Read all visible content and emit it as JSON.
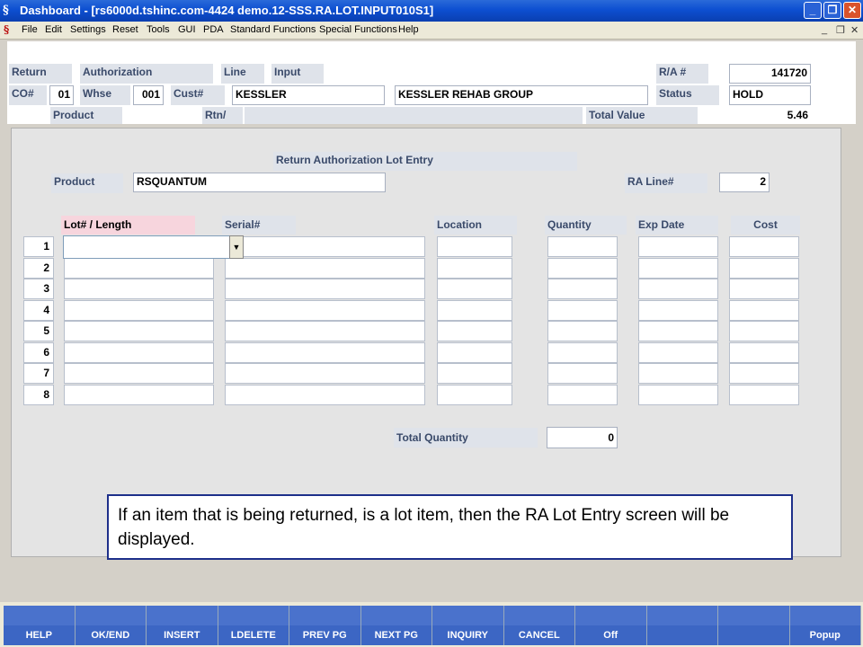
{
  "window": {
    "title": "Dashboard - [rs6000d.tshinc.com-4424 demo.12-SSS.RA.LOT.INPUT010S1]"
  },
  "menu": [
    "File",
    "Edit",
    "Settings",
    "Reset",
    "Tools",
    "GUI",
    "PDA",
    "Standard Functions",
    "Special Functions",
    "Help"
  ],
  "header": {
    "return_label": "Return",
    "authorization_label": "Authorization",
    "line_label": "Line",
    "input_label": "Input",
    "ra_label": "R/A #",
    "ra_value": "141720",
    "co_label": "CO#",
    "co_value": "01",
    "whse_label": "Whse",
    "whse_value": "001",
    "cust_label": "Cust#",
    "cust_value": "KESSLER",
    "cust_name": "KESSLER REHAB GROUP",
    "status_label": "Status",
    "status_value": "HOLD",
    "product_label": "Product",
    "rtn_label": "Rtn/",
    "total_value_label": "Total Value",
    "total_value": "5.46"
  },
  "lot_entry": {
    "title": "Return Authorization Lot Entry",
    "product_label": "Product",
    "product_value": "RSQUANTUM",
    "ra_line_label": "RA Line#",
    "ra_line_value": "2",
    "columns": [
      "Lot# / Length",
      "Serial#",
      "Location",
      "Quantity",
      "Exp Date",
      "Cost"
    ],
    "rows": [
      "1",
      "2",
      "3",
      "4",
      "5",
      "6",
      "7",
      "8"
    ],
    "total_quantity_label": "Total Quantity",
    "total_quantity_value": "0"
  },
  "note": "If an item that is being returned, is a lot item, then the RA Lot Entry screen will be displayed.",
  "function_keys": [
    "HELP",
    "OK/END",
    "INSERT",
    "LDELETE",
    "PREV PG",
    "NEXT PG",
    "INQUIRY",
    "CANCEL",
    "Off",
    "",
    "",
    "Popup"
  ]
}
